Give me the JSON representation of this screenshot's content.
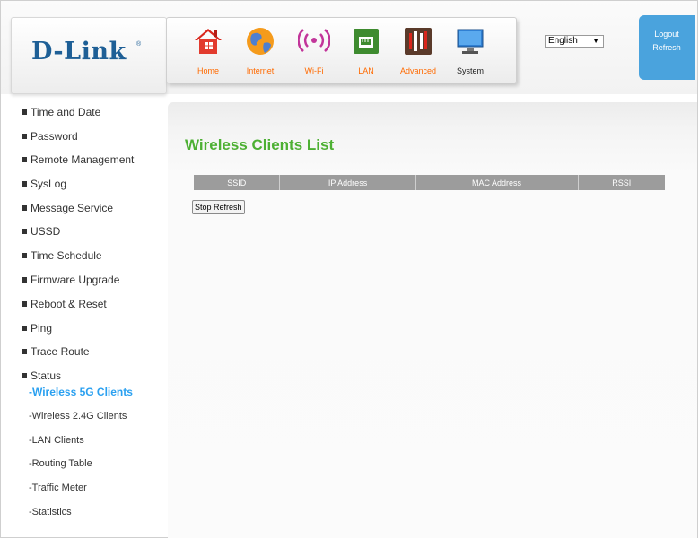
{
  "brand": {
    "logo_text": "D-Link",
    "registered_mark": "®"
  },
  "nav": {
    "items": [
      {
        "label": "Home",
        "icon": "home-icon"
      },
      {
        "label": "Internet",
        "icon": "globe-icon"
      },
      {
        "label": "Wi-Fi",
        "icon": "wifi-icon"
      },
      {
        "label": "LAN",
        "icon": "lan-icon"
      },
      {
        "label": "Advanced",
        "icon": "tools-icon"
      },
      {
        "label": "System",
        "icon": "computer-icon"
      }
    ]
  },
  "language": {
    "selected": "English",
    "arrow": "▼"
  },
  "account": {
    "logout_label": "Logout",
    "refresh_label": "Refresh"
  },
  "sidebar": {
    "items": [
      {
        "label": "Time and Date"
      },
      {
        "label": "Password"
      },
      {
        "label": "Remote Management"
      },
      {
        "label": "SysLog"
      },
      {
        "label": "Message Service"
      },
      {
        "label": "USSD"
      },
      {
        "label": "Time Schedule"
      },
      {
        "label": "Firmware Upgrade"
      },
      {
        "label": "Reboot & Reset"
      },
      {
        "label": "Ping"
      },
      {
        "label": "Trace Route"
      },
      {
        "label": "Status"
      }
    ],
    "status_subitems": [
      {
        "label": "-Wireless 5G Clients",
        "active": true
      },
      {
        "label": "-Wireless 2.4G Clients",
        "active": false
      },
      {
        "label": "-LAN Clients",
        "active": false
      },
      {
        "label": "-Routing Table",
        "active": false
      },
      {
        "label": "-Traffic Meter",
        "active": false
      },
      {
        "label": "-Statistics",
        "active": false
      }
    ]
  },
  "main": {
    "title": "Wireless Clients List",
    "table": {
      "columns": [
        "SSID",
        "IP Address",
        "MAC Address",
        "RSSI"
      ],
      "rows": []
    },
    "stop_refresh_label": "Stop Refresh"
  },
  "colors": {
    "accent_green": "#4db033",
    "accent_blue": "#4aa3dd",
    "nav_label_orange": "#ff6a00",
    "active_link": "#2aa0f0",
    "brand_blue": "#1e5f96"
  }
}
